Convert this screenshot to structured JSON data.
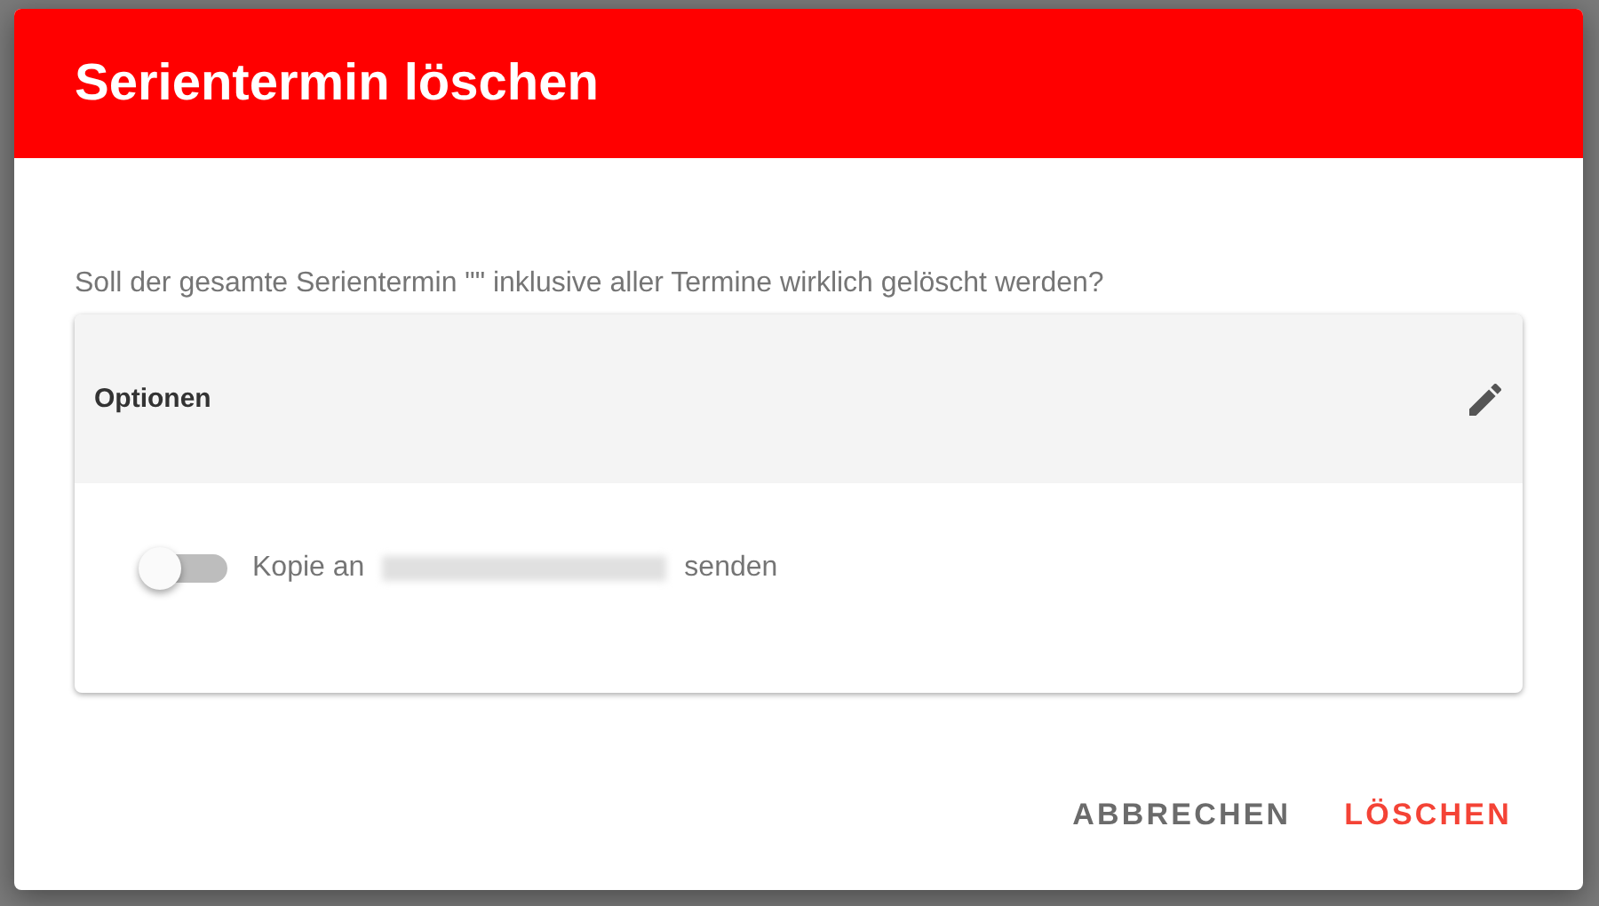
{
  "dialog": {
    "title": "Serientermin löschen",
    "message": "Soll der gesamte Serientermin \"\" inklusive aller Termine wirklich gelöscht werden?",
    "panel": {
      "title": "Optionen",
      "toggle": {
        "label_start": "Kopie an",
        "label_end": "senden",
        "on": false
      }
    },
    "buttons": [
      {
        "label": "ABBRECHEN",
        "kind": "neutral"
      },
      {
        "label": "LÖSCHEN",
        "kind": "danger"
      }
    ]
  }
}
